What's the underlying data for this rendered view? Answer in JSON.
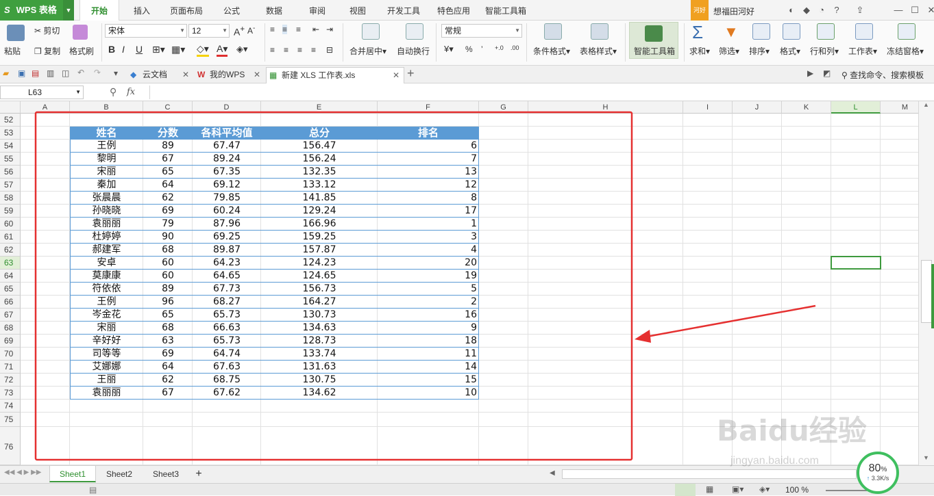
{
  "app": {
    "name": "WPS 表格",
    "logo": "S"
  },
  "menu": {
    "tabs": [
      "开始",
      "插入",
      "页面布局",
      "公式",
      "数据",
      "审阅",
      "视图",
      "开发工具",
      "特色应用",
      "智能工具箱"
    ],
    "active": "开始",
    "user_badge": "河好",
    "user_name": "想福田河好"
  },
  "ribbon": {
    "paste": "粘贴",
    "cut": "剪切",
    "copy": "复制",
    "format_painter": "格式刷",
    "font_name": "宋体",
    "font_size": "12",
    "bold": "B",
    "italic": "I",
    "underline": "U",
    "merge_center": "合并居中",
    "wrap_text": "自动换行",
    "number_format": "常规",
    "percent": "%",
    "comma": "’",
    "cond_format": "条件格式",
    "table_style": "表格样式",
    "smart_toolbox": "智能工具箱",
    "sum": "求和",
    "filter": "筛选",
    "sort": "排序",
    "format": "格式",
    "row_col": "行和列",
    "worksheet": "工作表",
    "freeze": "冻结窗格"
  },
  "docs": {
    "tabs": [
      {
        "label": "云文档",
        "icon": "cloud-icon"
      },
      {
        "label": "我的WPS",
        "icon": "wps-icon"
      },
      {
        "label": "新建 XLS 工作表.xls",
        "icon": "sheet-icon"
      }
    ],
    "search_placeholder": "查找命令、搜索模板"
  },
  "formula_bar": {
    "name_box": "L63",
    "fx": "fx",
    "value": ""
  },
  "grid": {
    "columns": [
      "A",
      "B",
      "C",
      "D",
      "E",
      "F",
      "G",
      "H",
      "I",
      "J",
      "K",
      "L",
      "M"
    ],
    "selected_column": "L",
    "rows": [
      "52",
      "53",
      "54",
      "55",
      "56",
      "57",
      "58",
      "59",
      "60",
      "61",
      "62",
      "63",
      "64",
      "65",
      "66",
      "67",
      "68",
      "69",
      "70",
      "71",
      "72",
      "73",
      "74",
      "75",
      "76"
    ],
    "selected_row": "63",
    "table_headers": [
      "姓名",
      "分数",
      "各科平均值",
      "总分",
      "排名"
    ],
    "table_rows": [
      [
        "王例",
        "89",
        "67.47",
        "156.47",
        "6"
      ],
      [
        "黎明",
        "67",
        "89.24",
        "156.24",
        "7"
      ],
      [
        "宋丽",
        "65",
        "67.35",
        "132.35",
        "13"
      ],
      [
        "秦加",
        "64",
        "69.12",
        "133.12",
        "12"
      ],
      [
        "张晨晨",
        "62",
        "79.85",
        "141.85",
        "8"
      ],
      [
        "孙晓晓",
        "69",
        "60.24",
        "129.24",
        "17"
      ],
      [
        "袁丽丽",
        "79",
        "87.96",
        "166.96",
        "1"
      ],
      [
        "杜婷婷",
        "90",
        "69.25",
        "159.25",
        "3"
      ],
      [
        "郝建军",
        "68",
        "89.87",
        "157.87",
        "4"
      ],
      [
        "安卓",
        "60",
        "64.23",
        "124.23",
        "20"
      ],
      [
        "莫康康",
        "60",
        "64.65",
        "124.65",
        "19"
      ],
      [
        "符依依",
        "89",
        "67.73",
        "156.73",
        "5"
      ],
      [
        "王例",
        "96",
        "68.27",
        "164.27",
        "2"
      ],
      [
        "岑金花",
        "65",
        "65.73",
        "130.73",
        "16"
      ],
      [
        "宋丽",
        "68",
        "66.63",
        "134.63",
        "9"
      ],
      [
        "辛好好",
        "63",
        "65.73",
        "128.73",
        "18"
      ],
      [
        "司等等",
        "69",
        "64.74",
        "133.74",
        "11"
      ],
      [
        "艾娜娜",
        "64",
        "67.63",
        "131.63",
        "14"
      ],
      [
        "王丽",
        "62",
        "68.75",
        "130.75",
        "15"
      ],
      [
        "袁丽丽",
        "67",
        "67.62",
        "134.62",
        "10"
      ]
    ]
  },
  "sheets": {
    "tabs": [
      "Sheet1",
      "Sheet2",
      "Sheet3"
    ],
    "active": "Sheet1",
    "add": "+"
  },
  "status": {
    "zoom": "100 %"
  },
  "net_widget": {
    "percent": "80",
    "unit": "%",
    "speed": "3.3K/s"
  },
  "watermark": {
    "brand": "Baidu经验",
    "url": "jingyan.baidu.com"
  },
  "colors": {
    "accent": "#3e9a3e",
    "table_header": "#5b9bd5",
    "annotation": "#e53030"
  }
}
